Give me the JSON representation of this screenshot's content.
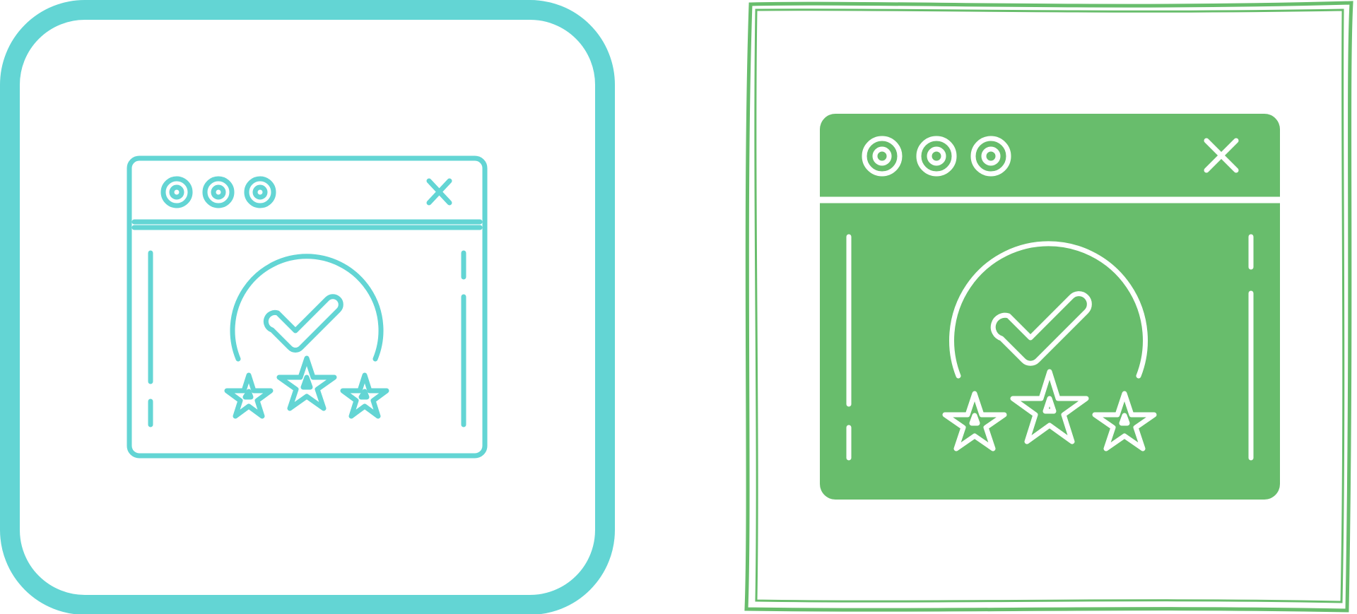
{
  "icons": [
    {
      "variant": "outline",
      "icon": "browser-rating-icon",
      "accent_color": "#63D5D4",
      "frame_color": "#63D5D4",
      "background": "#FFFFFF"
    },
    {
      "variant": "filled",
      "icon": "browser-rating-icon",
      "accent_color": "#68BD6C",
      "frame_color": "#68BD6C",
      "glyph_color": "#FFFFFF",
      "background": "#FFFFFF"
    }
  ],
  "rating": {
    "stars": 3,
    "check_mark": true,
    "window_dots": 3,
    "close_icon": true
  }
}
